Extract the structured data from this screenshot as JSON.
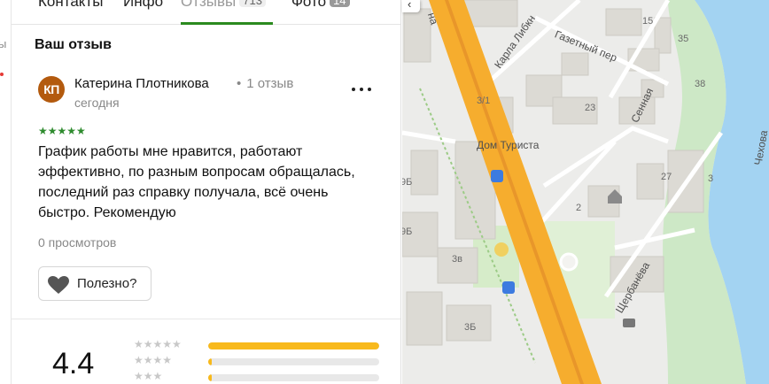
{
  "edge": {
    "ghost_text": "ы"
  },
  "tabs": [
    {
      "label": "Контакты"
    },
    {
      "label": "Инфо"
    },
    {
      "label": "Отзывы",
      "count": "713"
    },
    {
      "label": "Фото",
      "count": "14"
    }
  ],
  "active_tab": "Отзывы",
  "review": {
    "section_title": "Ваш отзыв",
    "avatar_initials": "КП",
    "author": "Катерина Плотникова",
    "author_reviews": "1 отзыв",
    "date": "сегодня",
    "rating": 5,
    "stars": "★★★★★",
    "text": "График работы мне нравится, работают эффективно, по разным вопросам обращалась, последний раз справку получала, всё очень быстро. Рекомендую",
    "views": "0 просмотров",
    "helpful_label": "Полезно?"
  },
  "summary": {
    "rating": "4.4",
    "distribution": [
      {
        "stars": "★★★★★",
        "fraction": 1.0
      },
      {
        "stars": "★★★★",
        "fraction": 0.02
      },
      {
        "stars": "★★★",
        "fraction": 0.02
      }
    ]
  },
  "map": {
    "labels": {
      "street_karla": "Карла Либкн",
      "street_gazetny": "Газетный пер",
      "street_sennaya": "Сенная",
      "street_chekhova": "Чехова",
      "street_shcherbaneva": "Щербанёва",
      "poi_dom_turista": "Дом Туриста",
      "street_main_fragment": "на"
    },
    "house_numbers": [
      "15",
      "35",
      "38",
      "23",
      "3/1",
      "27",
      "3",
      "2",
      "9Б",
      "9Б",
      "3в",
      "3Б"
    ]
  },
  "colors": {
    "accent_green": "#2b8a1e",
    "star_green": "#2e8b2e",
    "bar_yellow": "#f8b91c",
    "road_orange": "#f6ad2e",
    "water_blue": "#a3d3f2"
  }
}
